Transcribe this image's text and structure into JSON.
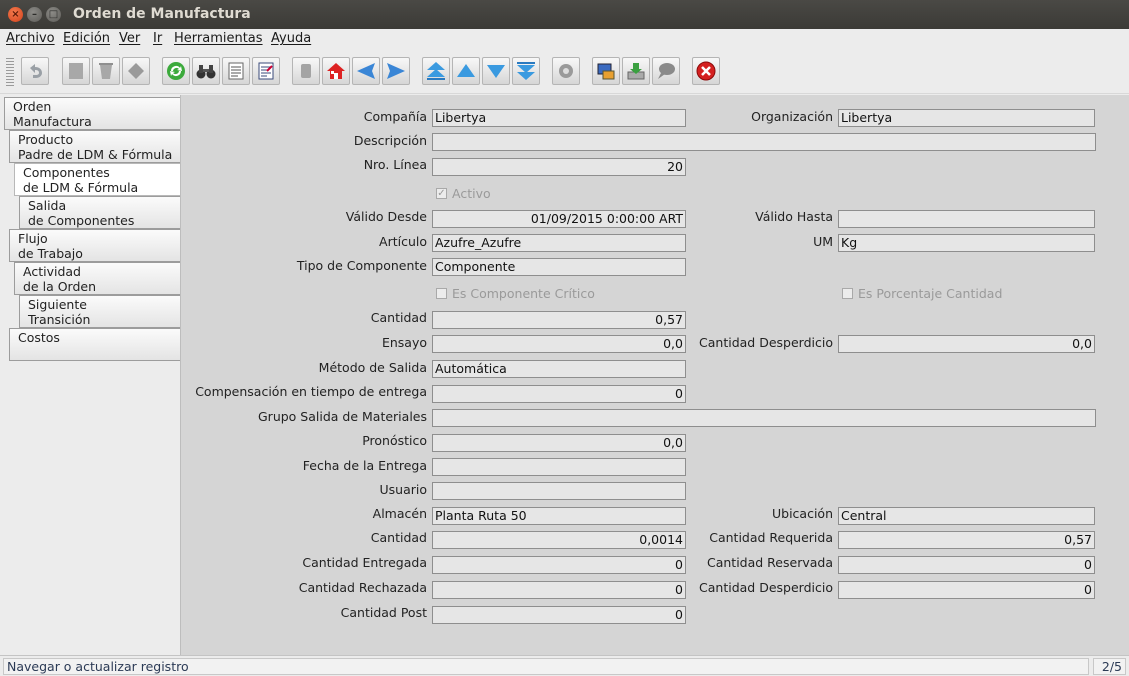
{
  "window": {
    "title": "Orden de Manufactura"
  },
  "menu": [
    "Archivo",
    "Edición",
    "Ver",
    "Ir",
    "Herramientas",
    "Ayuda"
  ],
  "toolbar": {
    "icons": [
      "undo-icon",
      "new-record-icon",
      "delete-icon",
      "delete-selection-icon",
      "refresh-icon",
      "find-icon",
      "report-icon",
      "history-icon",
      "attachment-icon",
      "home-icon",
      "previous-tab-icon",
      "next-tab-icon",
      "first-record-icon",
      "previous-record-icon",
      "next-record-icon",
      "last-record-icon",
      "workflow-icon",
      "zoom-across-icon",
      "archive-icon",
      "chat-icon",
      "close-icon"
    ]
  },
  "tabs": [
    {
      "line1": "Orden",
      "line2": "Manufactura"
    },
    {
      "line1": "Producto",
      "line2": "Padre de LDM & Fórmula"
    },
    {
      "line1": "Componentes",
      "line2": "de LDM & Fórmula"
    },
    {
      "line1": "Salida",
      "line2": "de Componentes"
    },
    {
      "line1": "Flujo",
      "line2": "de Trabajo"
    },
    {
      "line1": "Actividad",
      "line2": "de la Orden"
    },
    {
      "line1": "Siguiente",
      "line2": "Transición"
    },
    {
      "line1": "Costos",
      "line2": ""
    }
  ],
  "form": {
    "compania": {
      "label": "Compañía",
      "value": "Libertya"
    },
    "organizacion": {
      "label": "Organización",
      "value": "Libertya"
    },
    "descripcion": {
      "label": "Descripción",
      "value": ""
    },
    "nro_linea": {
      "label": "Nro. Línea",
      "value": "20"
    },
    "activo": {
      "label": "Activo",
      "checked": true
    },
    "valido_desde": {
      "label": "Válido Desde",
      "value": "01/09/2015 0:00:00 ART"
    },
    "valido_hasta": {
      "label": "Válido Hasta",
      "value": ""
    },
    "articulo": {
      "label": "Artículo",
      "value": "Azufre_Azufre"
    },
    "um": {
      "label": "UM",
      "value": "Kg"
    },
    "tipo_componente": {
      "label": "Tipo de Componente",
      "value": "Componente"
    },
    "es_componente_critico": {
      "label": "Es Componente Crítico",
      "checked": false
    },
    "es_porcentaje_cantidad": {
      "label": "Es Porcentaje Cantidad",
      "checked": false
    },
    "cantidad": {
      "label": "Cantidad",
      "value": "0,57"
    },
    "ensayo": {
      "label": "Ensayo",
      "value": "0,0"
    },
    "cantidad_desperdicio": {
      "label": "Cantidad Desperdicio",
      "value": "0,0"
    },
    "metodo_salida": {
      "label": "Método de Salida",
      "value": "Automática"
    },
    "compensacion": {
      "label": "Compensación en tiempo de entrega",
      "value": "0"
    },
    "grupo_salida": {
      "label": "Grupo Salida de Materiales",
      "value": ""
    },
    "pronostico": {
      "label": "Pronóstico",
      "value": "0,0"
    },
    "fecha_entrega": {
      "label": "Fecha de la Entrega",
      "value": ""
    },
    "usuario": {
      "label": "Usuario",
      "value": ""
    },
    "almacen": {
      "label": "Almacén",
      "value": "Planta Ruta 50"
    },
    "ubicacion": {
      "label": "Ubicación",
      "value": "Central"
    },
    "cantidad2": {
      "label": "Cantidad",
      "value": "0,0014"
    },
    "cantidad_requerida": {
      "label": "Cantidad Requerida",
      "value": "0,57"
    },
    "cantidad_entregada": {
      "label": "Cantidad Entregada",
      "value": "0"
    },
    "cantidad_reservada": {
      "label": "Cantidad Reservada",
      "value": "0"
    },
    "cantidad_rechazada": {
      "label": "Cantidad Rechazada",
      "value": "0"
    },
    "cantidad_desperdicio2": {
      "label": "Cantidad Desperdicio",
      "value": "0"
    },
    "cantidad_post": {
      "label": "Cantidad Post",
      "value": "0"
    }
  },
  "status": {
    "message": "Navegar o actualizar registro",
    "record": "2/5"
  }
}
